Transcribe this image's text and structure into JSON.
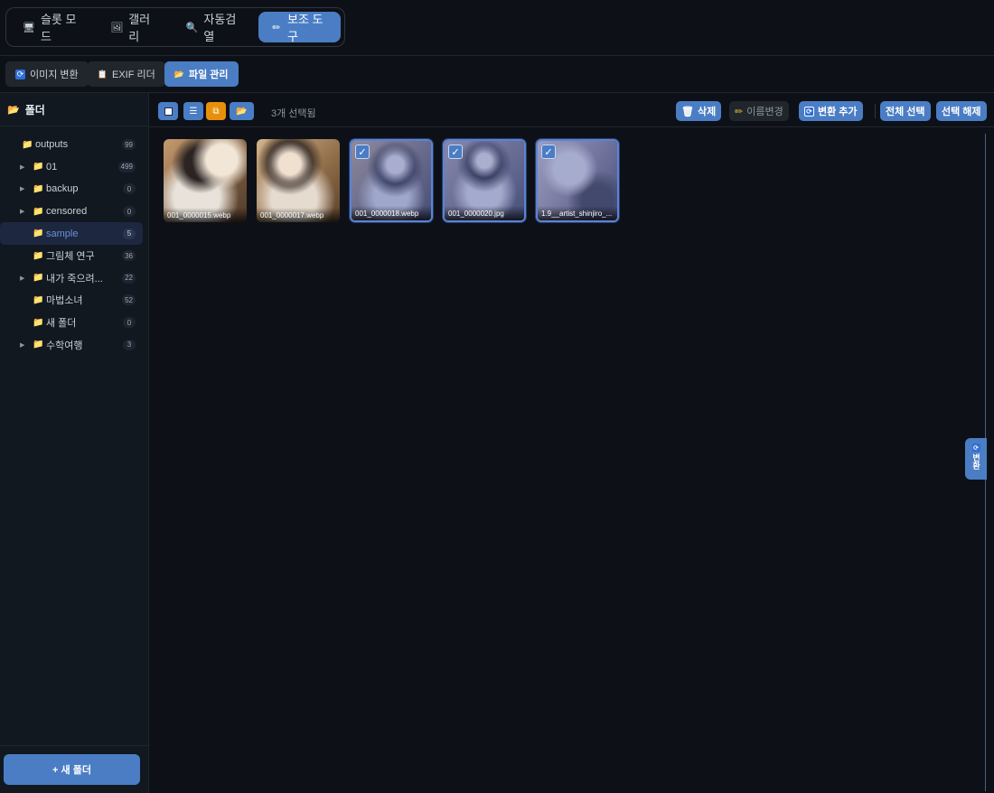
{
  "top_tabs": [
    {
      "label": "슬롯 모드",
      "icon": "monitor-icon"
    },
    {
      "label": "갤러리",
      "icon": "picture-icon"
    },
    {
      "label": "자동검열",
      "icon": "magnifier-icon"
    },
    {
      "label": "보조 도구",
      "icon": "pencil-icon"
    }
  ],
  "sub_tabs": [
    {
      "label": "이미지 변환",
      "icon": "convert-icon"
    },
    {
      "label": "EXIF 리더",
      "icon": "clipboard-icon"
    },
    {
      "label": "파일 관리",
      "icon": "folder-icon"
    }
  ],
  "sidebar": {
    "title": "폴더",
    "new_folder_label": "+ 새 폴더",
    "items": [
      {
        "label": "outputs",
        "count": "99",
        "expandable": false,
        "depth": 0
      },
      {
        "label": "01",
        "count": "499",
        "expandable": true,
        "depth": 1
      },
      {
        "label": "backup",
        "count": "0",
        "expandable": true,
        "depth": 1
      },
      {
        "label": "censored",
        "count": "0",
        "expandable": true,
        "depth": 1
      },
      {
        "label": "sample",
        "count": "5",
        "expandable": false,
        "depth": 1,
        "selected": true
      },
      {
        "label": "그림체 연구",
        "count": "36",
        "expandable": false,
        "depth": 1
      },
      {
        "label": "내가 죽으려...",
        "count": "22",
        "expandable": true,
        "depth": 1
      },
      {
        "label": "마법소녀",
        "count": "52",
        "expandable": false,
        "depth": 1
      },
      {
        "label": "새 폴더",
        "count": "0",
        "expandable": false,
        "depth": 1
      },
      {
        "label": "수학여행",
        "count": "3",
        "expandable": true,
        "depth": 1
      }
    ]
  },
  "toolbar": {
    "selection_text": "3개 선택됨",
    "delete_label": "삭제",
    "rename_label": "이름변경",
    "add_convert_label": "변환 추가",
    "select_all_label": "전체 선택",
    "deselect_label": "선택 해제"
  },
  "files": [
    {
      "name": "001_0000015.webp",
      "checked": false
    },
    {
      "name": "001_0000017.webp",
      "checked": false
    },
    {
      "name": "001_0000018.webp",
      "checked": true
    },
    {
      "name": "001_0000020.jpg",
      "checked": true
    },
    {
      "name": "1.9__artist_shinjiro_...",
      "checked": true
    }
  ],
  "side_panel": {
    "label": "변환"
  },
  "colors": {
    "accent": "#4a7dc4",
    "orange": "#e8900c",
    "folder": "#e8b84a",
    "background": "#0d1117"
  }
}
